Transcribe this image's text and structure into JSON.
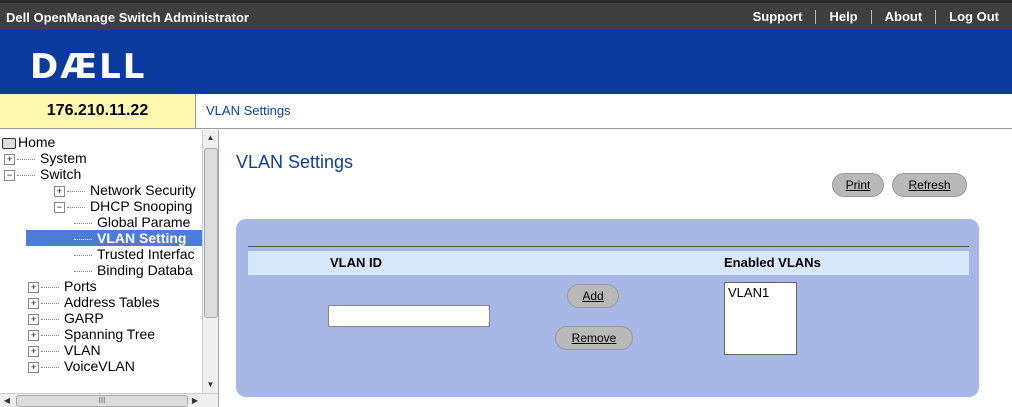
{
  "app": {
    "title": "Dell OpenManage Switch Administrator",
    "links": [
      "Support",
      "Help",
      "About",
      "Log Out"
    ],
    "logo_text": "DÆLL",
    "brand_color": "#0a3a9c"
  },
  "address": {
    "ip": "176.210.11.22",
    "breadcrumb": "VLAN Settings"
  },
  "tree": {
    "home": "Home",
    "system": "System",
    "switch": "Switch",
    "network_security": "Network Security",
    "dhcp_snooping": "DHCP Snooping",
    "global_params": "Global Parame",
    "vlan_settings": "VLAN Setting",
    "trusted_interfaces": "Trusted Interfac",
    "binding_database": "Binding Databa",
    "ports": "Ports",
    "address_tables": "Address Tables",
    "garp": "GARP",
    "spanning_tree": "Spanning Tree",
    "vlan": "VLAN",
    "voice_vlan": "VoiceVLAN",
    "hscroll_grip": "III"
  },
  "main": {
    "title": "VLAN Settings",
    "print_label": "Print",
    "refresh_label": "Refresh",
    "col_vlan_id": "VLAN ID",
    "col_enabled_vlans": "Enabled VLANs",
    "vlan_id_value": "",
    "add_label": "Add",
    "remove_label": "Remove",
    "enabled_vlans": [
      "VLAN1"
    ]
  }
}
